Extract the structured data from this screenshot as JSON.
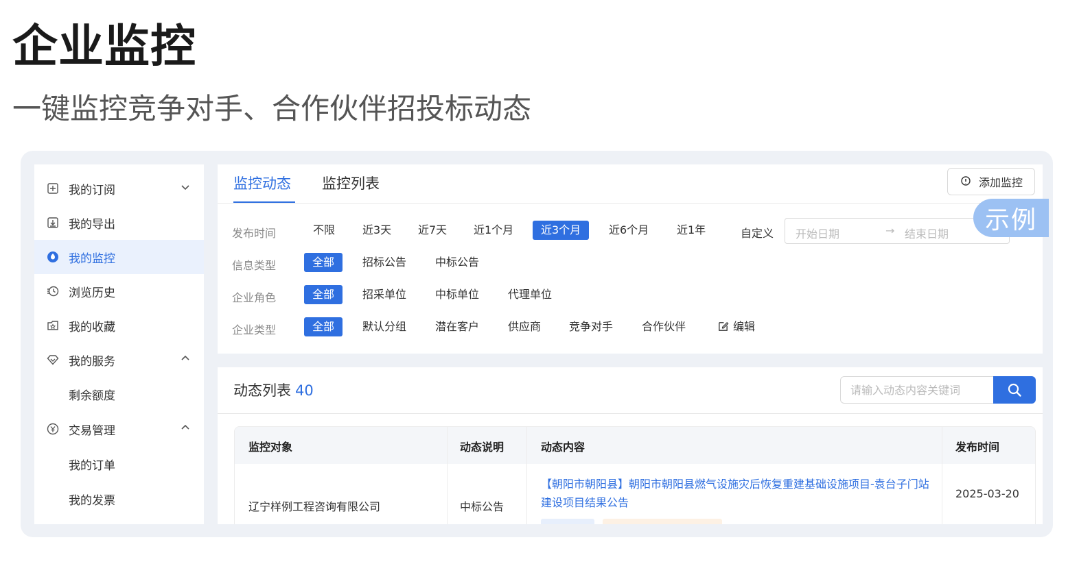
{
  "hero": {
    "title": "企业监控",
    "subtitle": "一键监控竞争对手、合作伙伴招投标动态"
  },
  "sidebar": {
    "items": [
      {
        "label": "我的订阅",
        "icon": "subscribe-icon",
        "chevron": "down"
      },
      {
        "label": "我的导出",
        "icon": "export-icon"
      },
      {
        "label": "我的监控",
        "icon": "monitor-icon",
        "active": true
      },
      {
        "label": "浏览历史",
        "icon": "history-icon"
      },
      {
        "label": "我的收藏",
        "icon": "favorite-icon"
      },
      {
        "label": "我的服务",
        "icon": "service-icon",
        "chevron": "up"
      },
      {
        "label": "剩余额度",
        "sub": true
      },
      {
        "label": "交易管理",
        "icon": "transaction-icon",
        "chevron": "up"
      },
      {
        "label": "我的订单",
        "sub": true
      },
      {
        "label": "我的发票",
        "sub": true
      }
    ]
  },
  "tabs": [
    {
      "label": "监控动态",
      "active": true
    },
    {
      "label": "监控列表",
      "active": false
    }
  ],
  "add_button": {
    "label": "添加监控",
    "icon": "add-monitor-icon"
  },
  "filters": {
    "publish_time": {
      "label": "发布时间",
      "options": [
        "不限",
        "近3天",
        "近7天",
        "近1个月",
        "近3个月",
        "近6个月",
        "近1年"
      ],
      "selected": "近3个月",
      "custom_label": "自定义",
      "start_placeholder": "开始日期",
      "end_placeholder": "结束日期",
      "arrow": "→"
    },
    "info_type": {
      "label": "信息类型",
      "options": [
        "全部",
        "招标公告",
        "中标公告"
      ],
      "selected": "全部"
    },
    "company_role": {
      "label": "企业角色",
      "options": [
        "全部",
        "招采单位",
        "中标单位",
        "代理单位"
      ],
      "selected": "全部"
    },
    "company_type": {
      "label": "企业类型",
      "options": [
        "全部",
        "默认分组",
        "潜在客户",
        "供应商",
        "竞争对手",
        "合作伙伴"
      ],
      "selected": "全部",
      "edit_label": "编辑"
    }
  },
  "example_badge": "示例",
  "list": {
    "title": "动态列表",
    "count": "40",
    "search_placeholder": "请输入动态内容关键词",
    "columns": [
      "监控对象",
      "动态说明",
      "动态内容",
      "发布时间"
    ],
    "rows": [
      {
        "target": "辽宁样例工程咨询有限公司",
        "description": "中标公告",
        "content": "【朝阳市朝阳县】朝阳市朝阳县燃气设施灾后恢复重建基础设施项目-袁台子门站建设项目结果公告",
        "date": "2025-03-20"
      }
    ]
  },
  "colors": {
    "accent": "#2f6fe0",
    "example_badge": "#9cc1f3",
    "frame_bg": "#eef1f6"
  }
}
